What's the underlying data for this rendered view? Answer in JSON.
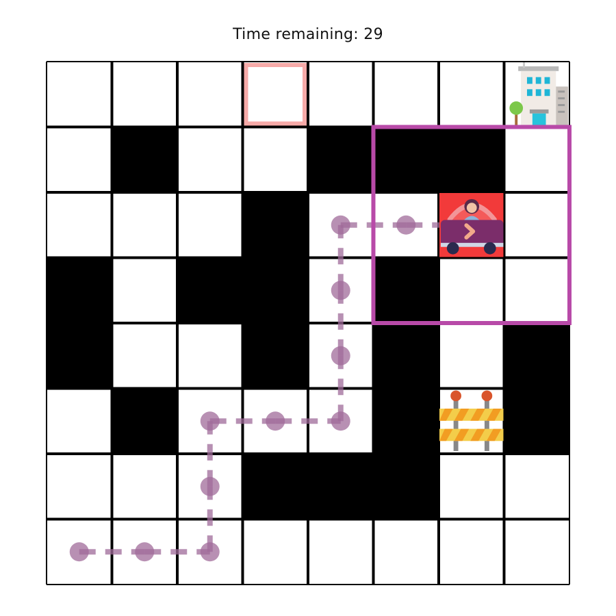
{
  "header": {
    "label": "Time remaining:",
    "value": "29"
  },
  "grid": {
    "rows": 8,
    "cols": 8,
    "walls": [
      [
        1,
        1
      ],
      [
        1,
        4
      ],
      [
        1,
        5
      ],
      [
        1,
        6
      ],
      [
        2,
        3
      ],
      [
        3,
        0
      ],
      [
        3,
        2
      ],
      [
        3,
        3
      ],
      [
        3,
        5
      ],
      [
        4,
        0
      ],
      [
        4,
        3
      ],
      [
        4,
        5
      ],
      [
        4,
        7
      ],
      [
        5,
        1
      ],
      [
        5,
        5
      ],
      [
        5,
        7
      ],
      [
        6,
        3
      ],
      [
        6,
        4
      ],
      [
        6,
        5
      ]
    ]
  },
  "colors": {
    "wall": "#000000",
    "grid_line": "#000000",
    "path": "#a06b9a",
    "view_window": "#b84aa8",
    "goal_marker": "#f7aaa8",
    "car_background": "#f23a3a",
    "car_body": "#7b2d6a"
  },
  "entities": {
    "car": {
      "row": 2,
      "col": 6,
      "icon": "car-with-driver-icon",
      "facing": "right"
    },
    "destination": {
      "row": 0,
      "col": 7,
      "icon": "office-building-icon"
    },
    "roadblock": {
      "row": 5,
      "col": 6,
      "icon": "roadblock-barrier-icon"
    },
    "goal_marker": {
      "row": 0,
      "col": 3
    }
  },
  "view_window": {
    "row_start": 1,
    "row_end": 3,
    "col_start": 5,
    "col_end": 7
  },
  "path": [
    [
      7,
      0
    ],
    [
      7,
      1
    ],
    [
      7,
      2
    ],
    [
      6,
      2
    ],
    [
      5,
      2
    ],
    [
      5,
      3
    ],
    [
      5,
      4
    ],
    [
      4,
      4
    ],
    [
      3,
      4
    ],
    [
      2,
      4
    ],
    [
      2,
      5
    ],
    [
      2,
      6
    ]
  ]
}
